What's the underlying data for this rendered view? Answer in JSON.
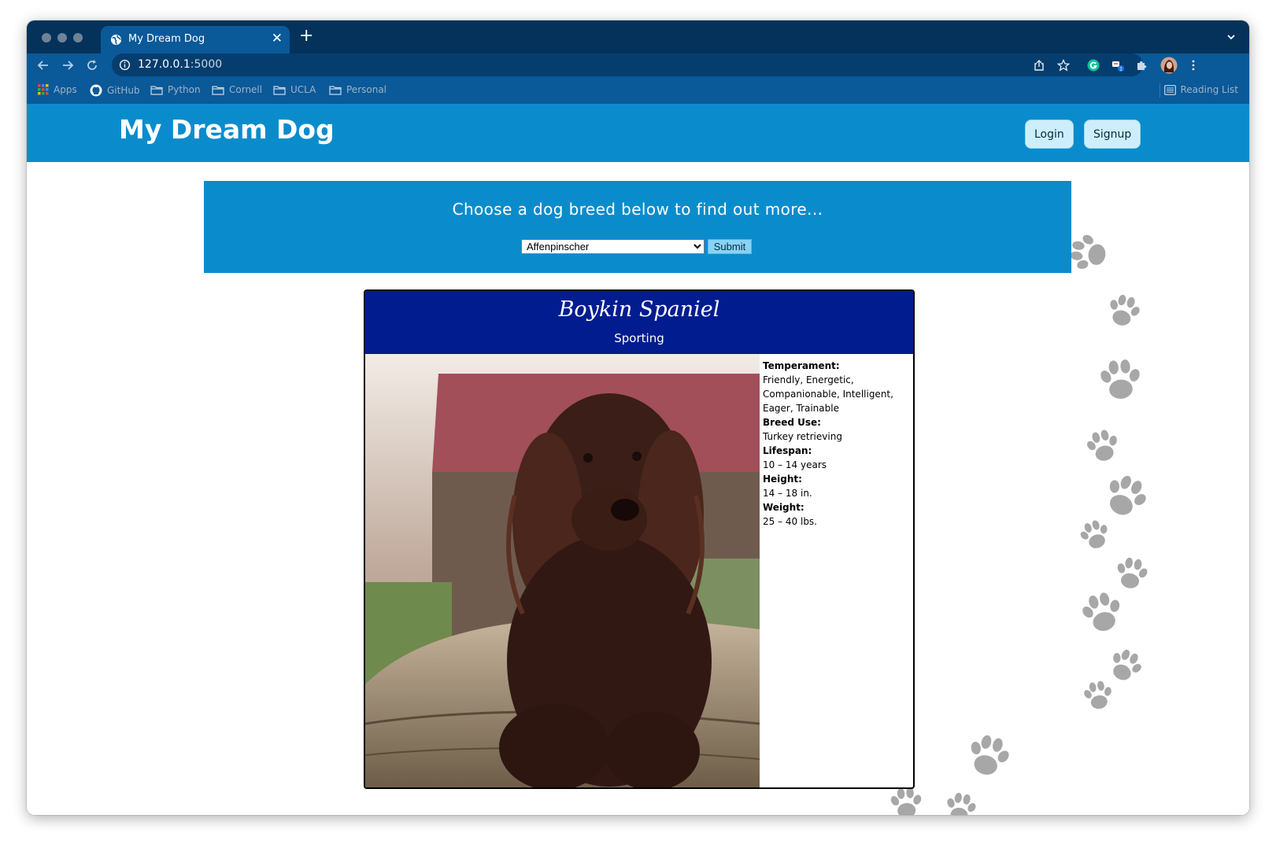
{
  "browser": {
    "tab_title": "My Dream Dog",
    "url_host": "127.0.0.1",
    "url_port": ":5000",
    "bookmarks": [
      "Apps",
      "GitHub",
      "Python",
      "Cornell",
      "UCLA",
      "Personal"
    ],
    "reading_list": "Reading List",
    "extension_badge": "1",
    "icons": [
      "back-arrow-icon",
      "forward-arrow-icon",
      "reload-icon",
      "info-icon",
      "share-icon",
      "star-icon",
      "grammarly-icon",
      "extension-icon",
      "puzzle-icon",
      "profile-avatar",
      "kebab-menu-icon"
    ]
  },
  "site": {
    "title": "My Dream Dog",
    "login_label": "Login",
    "signup_label": "Signup",
    "brand_color": "#0a8ccc"
  },
  "chooser": {
    "prompt": "Choose a dog breed below to find out more...",
    "selected_breed": "Affenpinscher",
    "submit_label": "Submit"
  },
  "breed": {
    "name": "Boykin Spaniel",
    "group": "Sporting",
    "header_color": "#001c8f",
    "facts": [
      {
        "label": "Temperament:",
        "value": "Friendly, Energetic, Companionable, Intelligent, Eager, Trainable"
      },
      {
        "label": "Breed Use:",
        "value": "Turkey retrieving"
      },
      {
        "label": "Lifespan:",
        "value": "10 – 14 years"
      },
      {
        "label": "Height:",
        "value": "14 – 18 in."
      },
      {
        "label": "Weight:",
        "value": "25 – 40 lbs."
      }
    ]
  }
}
